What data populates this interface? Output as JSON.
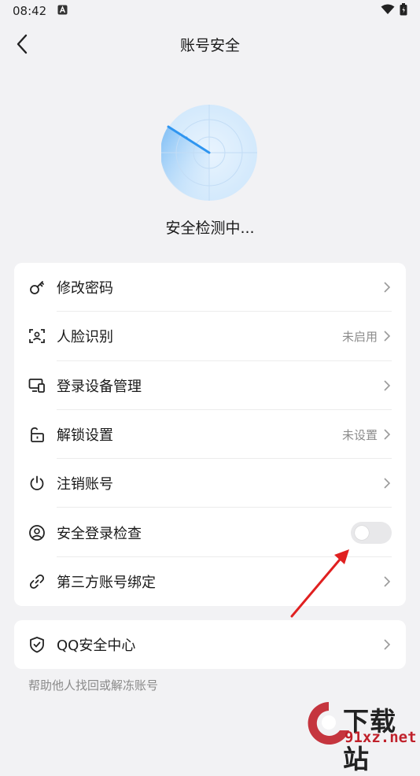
{
  "status_bar": {
    "time": "08:42"
  },
  "header": {
    "title": "账号安全"
  },
  "scan": {
    "text": "安全检测中..."
  },
  "settings": {
    "items": [
      {
        "label": "修改密码",
        "status": "",
        "icon": "key-icon"
      },
      {
        "label": "人脸识别",
        "status": "未启用",
        "icon": "face-scan-icon"
      },
      {
        "label": "登录设备管理",
        "status": "",
        "icon": "devices-icon"
      },
      {
        "label": "解锁设置",
        "status": "未设置",
        "icon": "unlock-icon"
      },
      {
        "label": "注销账号",
        "status": "",
        "icon": "power-icon"
      },
      {
        "label": "安全登录检查",
        "status": "",
        "icon": "user-circle-icon",
        "toggle": false
      },
      {
        "label": "第三方账号绑定",
        "status": "",
        "icon": "link-icon"
      }
    ]
  },
  "qq_center": {
    "label": "QQ安全中心",
    "icon": "shield-check-icon"
  },
  "help": {
    "text": "帮助他人找回或解冻账号"
  },
  "watermark": {
    "brand": "下载站",
    "domain": "91xz.net"
  },
  "colors": {
    "accent": "#2f95f0",
    "annotation_arrow": "#e02020",
    "background": "#f2f2f4"
  }
}
